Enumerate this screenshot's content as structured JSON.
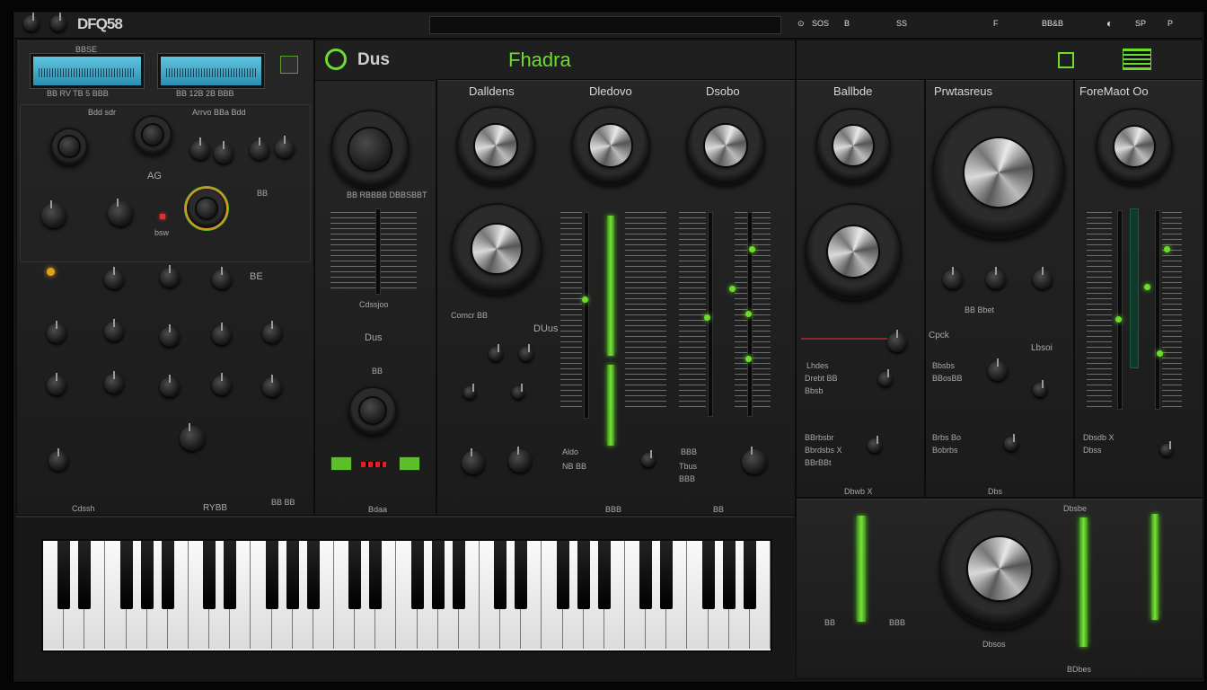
{
  "app": {
    "logo": "DFQ58",
    "subtitle": "BBSE",
    "screen_left_caption": "BB RV TB 5 BBB",
    "screen_right_caption": "BB 12B 2B BBB"
  },
  "toolbar": {
    "items": [
      "⊙",
      "SOS",
      "B",
      "SS",
      "F",
      "BB&B",
      "◐",
      "SP",
      "P"
    ]
  },
  "brand": {
    "name": "Dus",
    "preset": "Fhadra"
  },
  "left": {
    "row1_label": "Bdd sdr",
    "row1_right_label": "Arrvo BBa Bdd",
    "ag": "AG",
    "bb": "BB",
    "bsw": "bsw",
    "be": "BE",
    "bottom_left": "Cdssh",
    "bottom_mid": "RYBB",
    "bottom_right": "BB BB"
  },
  "col2": {
    "label1": "BB RBBBB DBBSBBT",
    "label2": "Cdssjoo",
    "label3": "Dus",
    "label4": "BB",
    "bottom": "Bdaa"
  },
  "section1": {
    "headers": [
      "Dalldens",
      "Dledovo",
      "Dsobo"
    ],
    "label_left": "Comcr BB",
    "dus": "DUus",
    "bb1": "Aldo",
    "bb2": "NB BB",
    "bb3": "BBB",
    "bb4": "Tbus",
    "bb5": "BBB",
    "bottom_left": "BBB",
    "bottom_right": "BB"
  },
  "section2": {
    "headers": [
      "Ballbde",
      "Prwtasreus",
      "ForeMaot Oo"
    ],
    "labels": [
      "Lhdes",
      "Drebt BB",
      "Bbsb",
      "Cpck",
      "BB Bbet",
      "Lbsoi",
      "Bbsbs",
      "BBosBB",
      "BBrbsbr",
      "Bbrdsbs X",
      "BBrBBt",
      "Brbs Bo",
      "Bobrbs",
      "Dbsdb X",
      "Dbss"
    ],
    "bottom_a": "Dbwb X",
    "bottom_b": "Dbs"
  },
  "bottom_right": {
    "top_label": "Dbsbe",
    "mid_label": "Dbsos",
    "bottom_label": "BDbes",
    "left_small": "BB",
    "left_small2": "BBB"
  },
  "colors": {
    "accent": "#6ddc2f",
    "panel": "#222222",
    "screen": "#4fb6d6"
  }
}
